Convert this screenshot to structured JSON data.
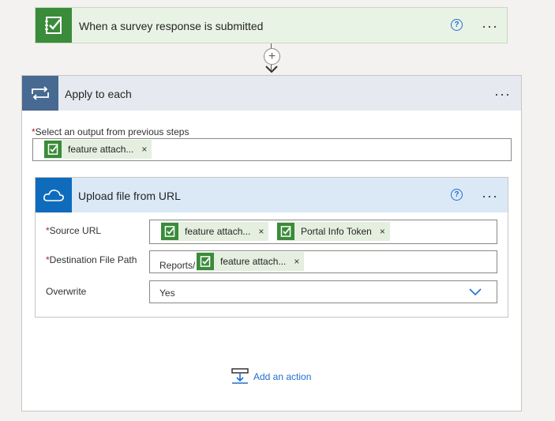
{
  "trigger": {
    "title": "When a survey response is submitted",
    "help": "?",
    "more": "···"
  },
  "connector": {
    "plus": "+"
  },
  "apply_each": {
    "title": "Apply to each",
    "more": "···",
    "output_label": "Select an output from previous steps",
    "required_mark": "*",
    "token": {
      "label": "feature attach...",
      "remove": "×"
    }
  },
  "upload": {
    "title": "Upload file from URL",
    "help": "?",
    "more": "···",
    "source_url": {
      "label": "Source URL",
      "tokens": [
        {
          "label": "feature attach...",
          "remove": "×"
        },
        {
          "label": "Portal Info Token",
          "remove": "×"
        }
      ]
    },
    "destination": {
      "label": "Destination File Path",
      "prefix": "Reports/",
      "token": {
        "label": "feature attach...",
        "remove": "×"
      }
    },
    "overwrite": {
      "label": "Overwrite",
      "value": "Yes"
    }
  },
  "add_action": {
    "label": "Add an action"
  },
  "colors": {
    "trigger_green": "#3a8b3a",
    "loop_blue": "#486991",
    "onedrive_blue": "#0f6cbd",
    "link_blue": "#1f6fd1",
    "required_red": "#a4262c"
  }
}
